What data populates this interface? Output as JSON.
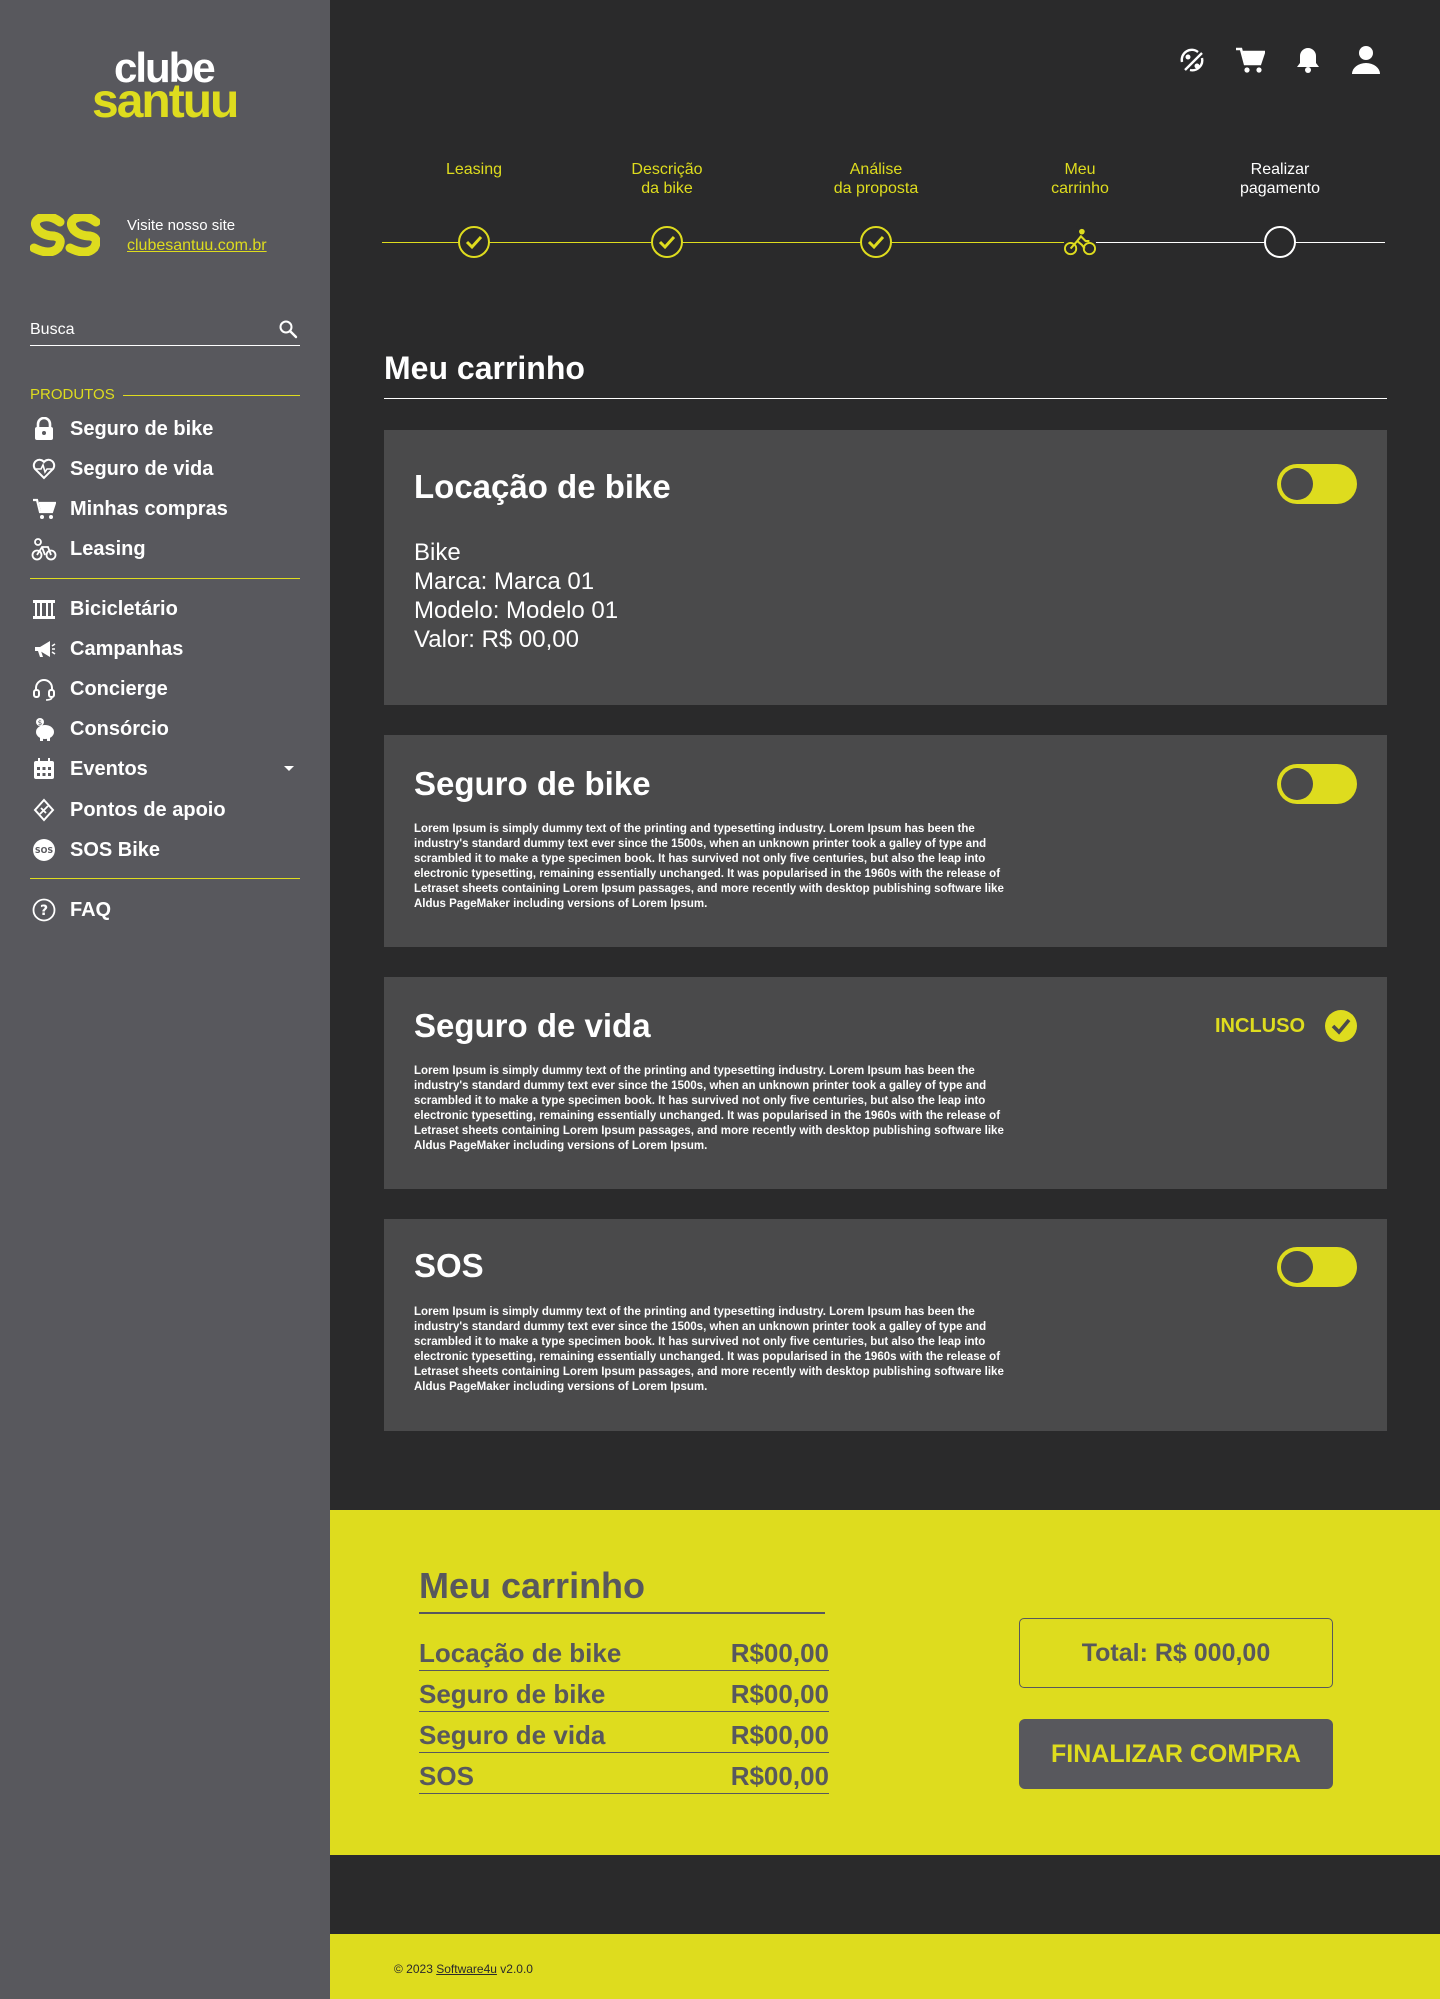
{
  "brand": {
    "logo_top": "clube",
    "logo_bottom": "santuu",
    "visit_label": "Visite nosso site",
    "site_url": "clubesantuu.com.br"
  },
  "search": {
    "placeholder": "Busca"
  },
  "sidebar": {
    "section_label": "PRODUTOS",
    "products": [
      {
        "label": "Seguro de bike",
        "icon": "lock-icon"
      },
      {
        "label": "Seguro de vida",
        "icon": "heart-pulse-icon"
      },
      {
        "label": "Minhas compras",
        "icon": "cart-icon"
      },
      {
        "label": "Leasing",
        "icon": "bike-key-icon"
      }
    ],
    "services": [
      {
        "label": "Bicicletário",
        "icon": "bike-rack-icon"
      },
      {
        "label": "Campanhas",
        "icon": "megaphone-icon"
      },
      {
        "label": "Concierge",
        "icon": "headset-icon"
      },
      {
        "label": "Consórcio",
        "icon": "piggy-bank-icon"
      },
      {
        "label": "Eventos",
        "icon": "calendar-icon"
      },
      {
        "label": "Pontos de apoio",
        "icon": "support-point-icon"
      },
      {
        "label": "SOS Bike",
        "icon": "sos-icon"
      }
    ],
    "faq": {
      "label": "FAQ",
      "icon": "help-circle-icon"
    }
  },
  "stepper": {
    "steps": [
      {
        "label": "Leasing",
        "state": "done"
      },
      {
        "label": "Descrição\nda bike",
        "state": "done"
      },
      {
        "label": "Análise\nda proposta",
        "state": "done"
      },
      {
        "label": "Meu\ncarrinho",
        "state": "current"
      },
      {
        "label": "Realizar\npagamento",
        "state": "todo"
      }
    ]
  },
  "main": {
    "title": "Meu carrinho",
    "cards": {
      "locacao": {
        "title": "Locação de bike",
        "line1": "Bike",
        "line2": "Marca: Marca 01",
        "line3": "Modelo: Modelo 01",
        "line4": "Valor: R$ 00,00"
      },
      "seguro_bike": {
        "title": "Seguro de bike",
        "desc": "Lorem Ipsum is simply dummy text of the printing and typesetting industry. Lorem Ipsum has been the industry's standard dummy text ever since the 1500s, when an unknown printer took a galley of type and scrambled it to make a type specimen book. It has survived not only five centuries, but also the leap into electronic typesetting, remaining essentially unchanged. It was popularised in the 1960s with the release of Letraset sheets containing Lorem Ipsum passages, and more recently with desktop publishing software like Aldus PageMaker including versions of Lorem Ipsum."
      },
      "seguro_vida": {
        "title": "Seguro de vida",
        "included_label": "INCLUSO",
        "desc": "Lorem Ipsum is simply dummy text of the printing and typesetting industry. Lorem Ipsum has been the industry's standard dummy text ever since the 1500s, when an unknown printer took a galley of type and scrambled it to make a type specimen book. It has survived not only five centuries, but also the leap into electronic typesetting, remaining essentially unchanged. It was popularised in the 1960s with the release of Letraset sheets containing Lorem Ipsum passages, and more recently with desktop publishing software like Aldus PageMaker including versions of Lorem Ipsum."
      },
      "sos": {
        "title": "SOS",
        "desc": "Lorem Ipsum is simply dummy text of the printing and typesetting industry. Lorem Ipsum has been the industry's standard dummy text ever since the 1500s, when an unknown printer took a galley of type and scrambled it to make a type specimen book. It has survived not only five centuries, but also the leap into electronic typesetting, remaining essentially unchanged. It was popularised in the 1960s with the release of Letraset sheets containing Lorem Ipsum passages, and more recently with desktop publishing software like Aldus PageMaker including versions of Lorem Ipsum."
      }
    }
  },
  "summary": {
    "title": "Meu carrinho",
    "rows": [
      {
        "name": "Locação de bike",
        "value": "R$00,00"
      },
      {
        "name": "Seguro de bike",
        "value": "R$00,00"
      },
      {
        "name": "Seguro de vida",
        "value": "R$00,00"
      },
      {
        "name": "SOS",
        "value": "R$00,00"
      }
    ],
    "total": "Total: R$ 000,00",
    "finalize_label": "FINALIZAR COMPRA"
  },
  "footer": {
    "copyright": "© 2023",
    "company": "Software4u",
    "version": "v2.0.0"
  },
  "colors": {
    "accent": "#dedc1e",
    "sidebar_bg": "#58585d",
    "page_bg": "#2a2a2b",
    "card_bg": "#4a4a4b"
  }
}
